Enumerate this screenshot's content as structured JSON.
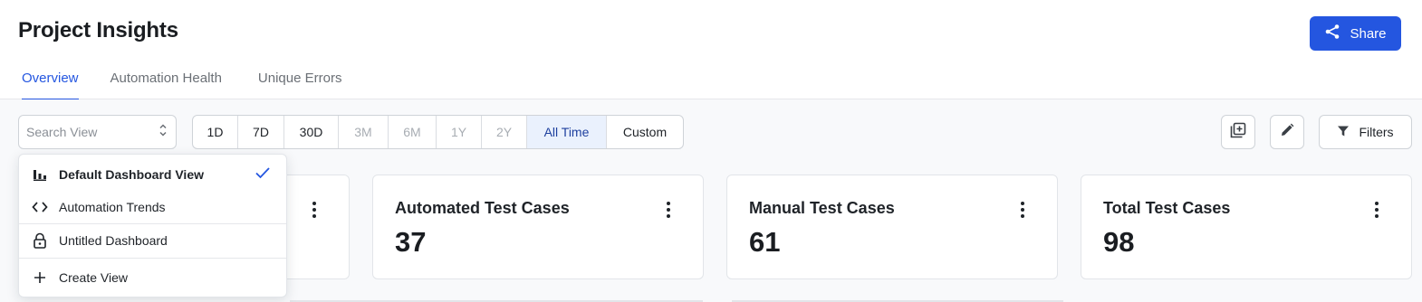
{
  "header": {
    "title": "Project Insights",
    "share_label": "Share",
    "tabs": [
      {
        "label": "Overview",
        "active": true
      },
      {
        "label": "Automation Health",
        "active": false
      },
      {
        "label": "Unique Errors",
        "active": false
      }
    ]
  },
  "toolbar": {
    "search_placeholder": "Search View",
    "ranges": [
      {
        "label": "1D",
        "state": "enabled"
      },
      {
        "label": "7D",
        "state": "enabled"
      },
      {
        "label": "30D",
        "state": "enabled"
      },
      {
        "label": "3M",
        "state": "disabled"
      },
      {
        "label": "6M",
        "state": "disabled"
      },
      {
        "label": "1Y",
        "state": "disabled"
      },
      {
        "label": "2Y",
        "state": "disabled"
      },
      {
        "label": "All Time",
        "state": "selected"
      },
      {
        "label": "Custom",
        "state": "enabled"
      }
    ],
    "filters_label": "Filters"
  },
  "dropdown": {
    "items": [
      {
        "label": "Default Dashboard View",
        "icon": "bar-chart-icon",
        "selected": true
      },
      {
        "label": "Automation Trends",
        "icon": "code-icon",
        "selected": false
      },
      {
        "label": "Untitled Dashboard",
        "icon": "lock-icon",
        "selected": false
      },
      {
        "label": "Create View",
        "icon": "plus-icon",
        "selected": false
      }
    ]
  },
  "cards": [
    {
      "title": "Automated Test Cases",
      "value": "37"
    },
    {
      "title": "Manual Test Cases",
      "value": "61"
    },
    {
      "title": "Total Test Cases",
      "value": "98"
    }
  ],
  "colors": {
    "accent": "#2456e0",
    "selected_range_bg": "#eaf1fd",
    "page_bg": "#f8f9fb"
  }
}
